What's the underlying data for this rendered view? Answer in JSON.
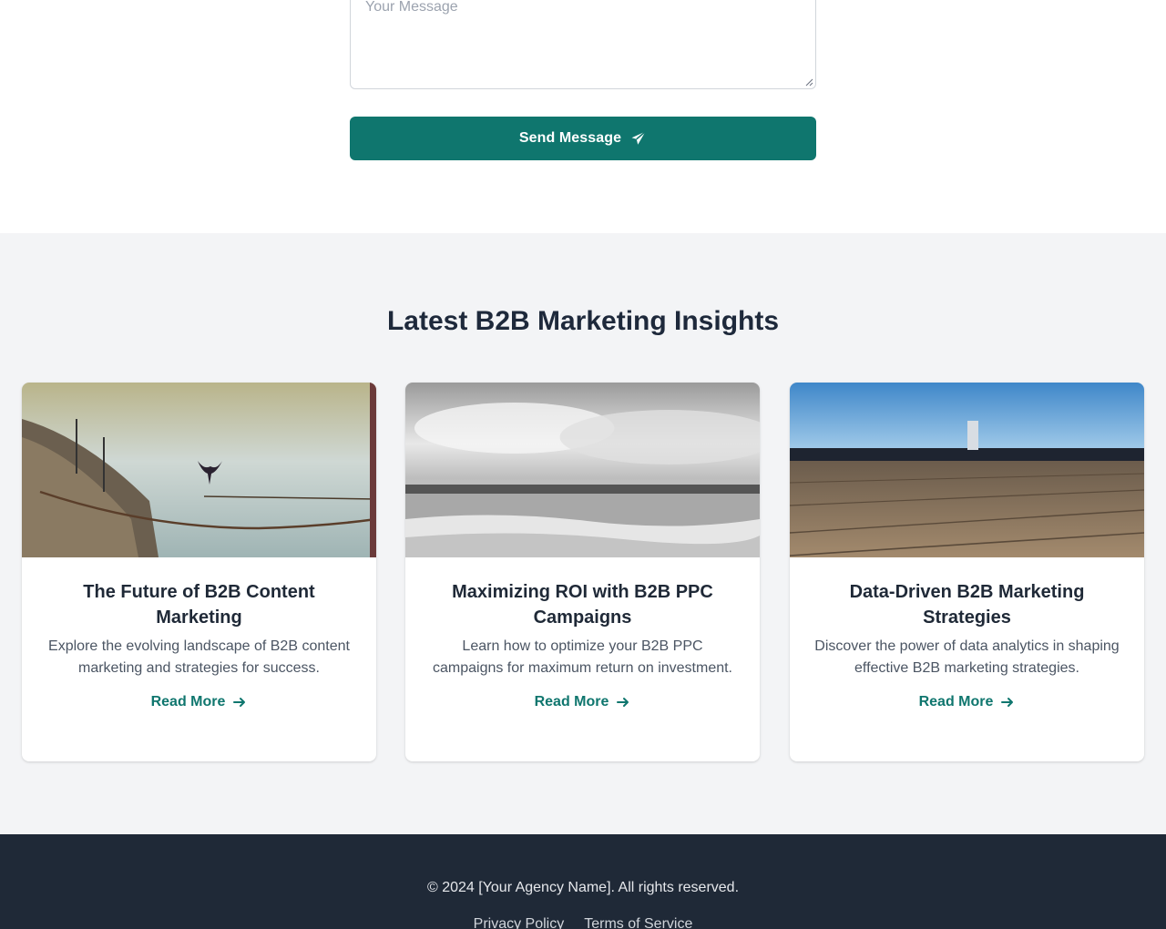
{
  "contact": {
    "message_placeholder": "Your Message",
    "send_label": "Send Message",
    "send_icon": "paper-plane-icon",
    "accent": "#0f766e"
  },
  "insights": {
    "title": "Latest B2B Marketing Insights",
    "cards": [
      {
        "title": "The Future of B2B Content Marketing",
        "description": "Explore the evolving landscape of B2B content marketing and strategies for success.",
        "link": "Read More",
        "image": "boat-deck-with-bird-photo"
      },
      {
        "title": "Maximizing ROI with B2B PPC Campaigns",
        "description": "Learn how to optimize your B2B PPC campaigns for maximum return on investment.",
        "link": "Read More",
        "image": "black-and-white-seascape-photo"
      },
      {
        "title": "Data-Driven B2B Marketing Strategies",
        "description": "Discover the power of data analytics in shaping effective B2B marketing strategies.",
        "link": "Read More",
        "image": "wooden-pier-photo"
      }
    ]
  },
  "footer": {
    "copyright": "© 2024 [Your Agency Name]. All rights reserved.",
    "links": [
      "Privacy Policy",
      "Terms of Service"
    ],
    "background": "#1f2937"
  }
}
